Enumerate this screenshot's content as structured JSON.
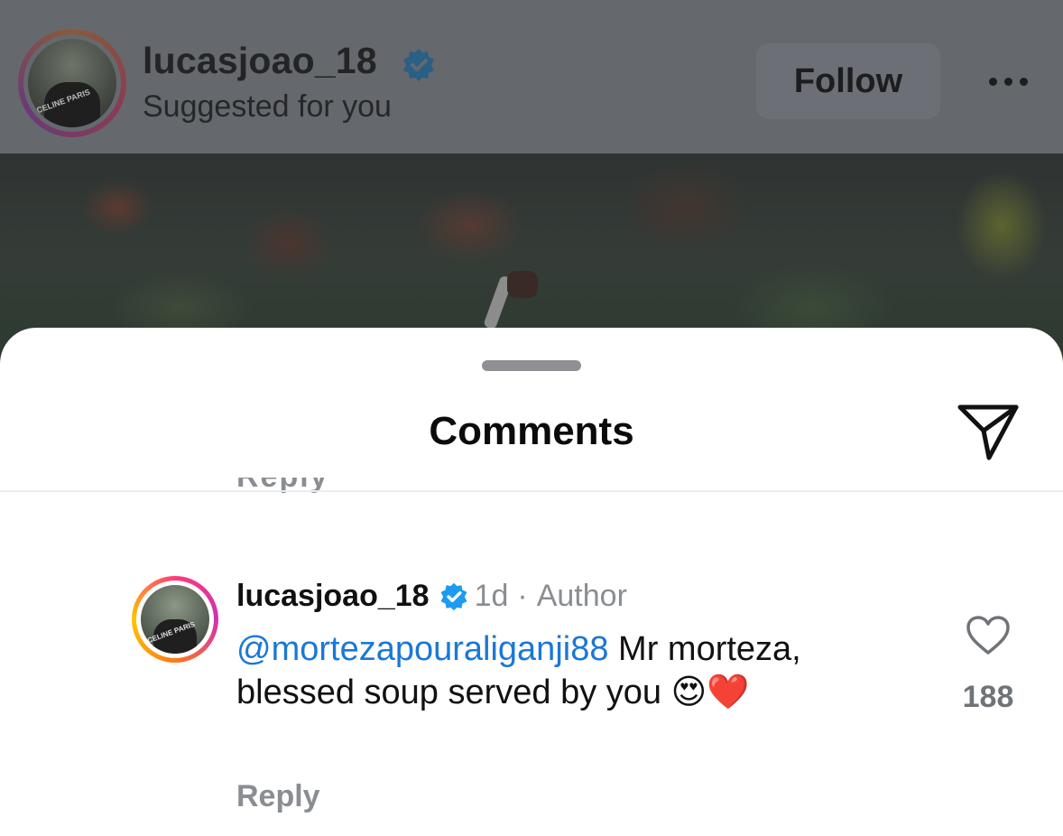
{
  "post_header": {
    "username": "lucasjoao_18",
    "subtitle": "Suggested for you",
    "follow_label": "Follow",
    "avatar_text": "CELINE PARIS",
    "verified_icon": "verified-badge-icon",
    "more_icon": "more-horizontal-icon"
  },
  "sheet": {
    "title": "Comments",
    "share_icon": "send-paper-plane-icon",
    "cut_off_text": "Reply"
  },
  "comment": {
    "username": "lucasjoao_18",
    "time": "1d",
    "separator": "·",
    "author_label": "Author",
    "mention": "@mortezapouraliganji88",
    "text": " Mr morteza, blessed soup served by you ",
    "emojis": "😍❤️",
    "reply_label": "Reply",
    "like_count": "188",
    "like_icon": "heart-outline-icon"
  },
  "colors": {
    "accent_blue": "#1a78d6",
    "verified_blue": "#1d9bf0",
    "muted_gray": "#8a8d91",
    "heart_red": "#e0162b"
  }
}
